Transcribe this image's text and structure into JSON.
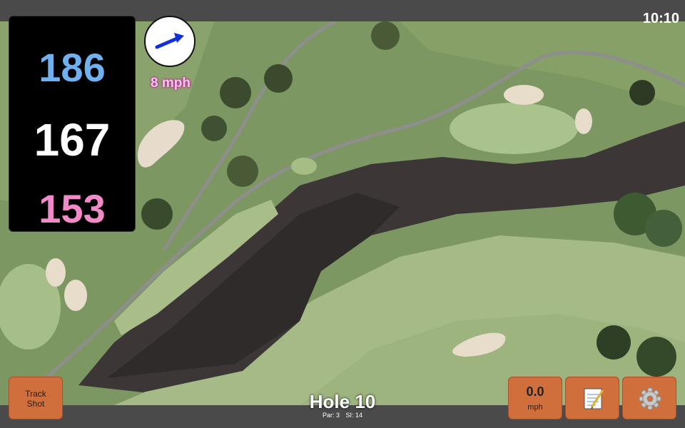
{
  "status_bar": {
    "time": "10:10"
  },
  "distances": {
    "back": "186",
    "middle": "167",
    "front": "153"
  },
  "wind": {
    "speed_label": "8 mph",
    "direction_icon": "arrow-icon",
    "arrow_color": "#1130d8"
  },
  "controls": {
    "track_shot_line1": "Track",
    "track_shot_line2": "Shot",
    "speed_value": "0.0",
    "speed_unit": "mph",
    "notes_icon": "notepad-icon",
    "settings_icon": "gear-icon"
  },
  "hole": {
    "title": "Hole 10",
    "par": "Par: 3",
    "si": "SI: 14"
  },
  "colors": {
    "button": "#d06f3c",
    "back_distance": "#6fb0ef",
    "front_distance": "#f28ac9",
    "wind_text_glow": "#c20f99"
  }
}
